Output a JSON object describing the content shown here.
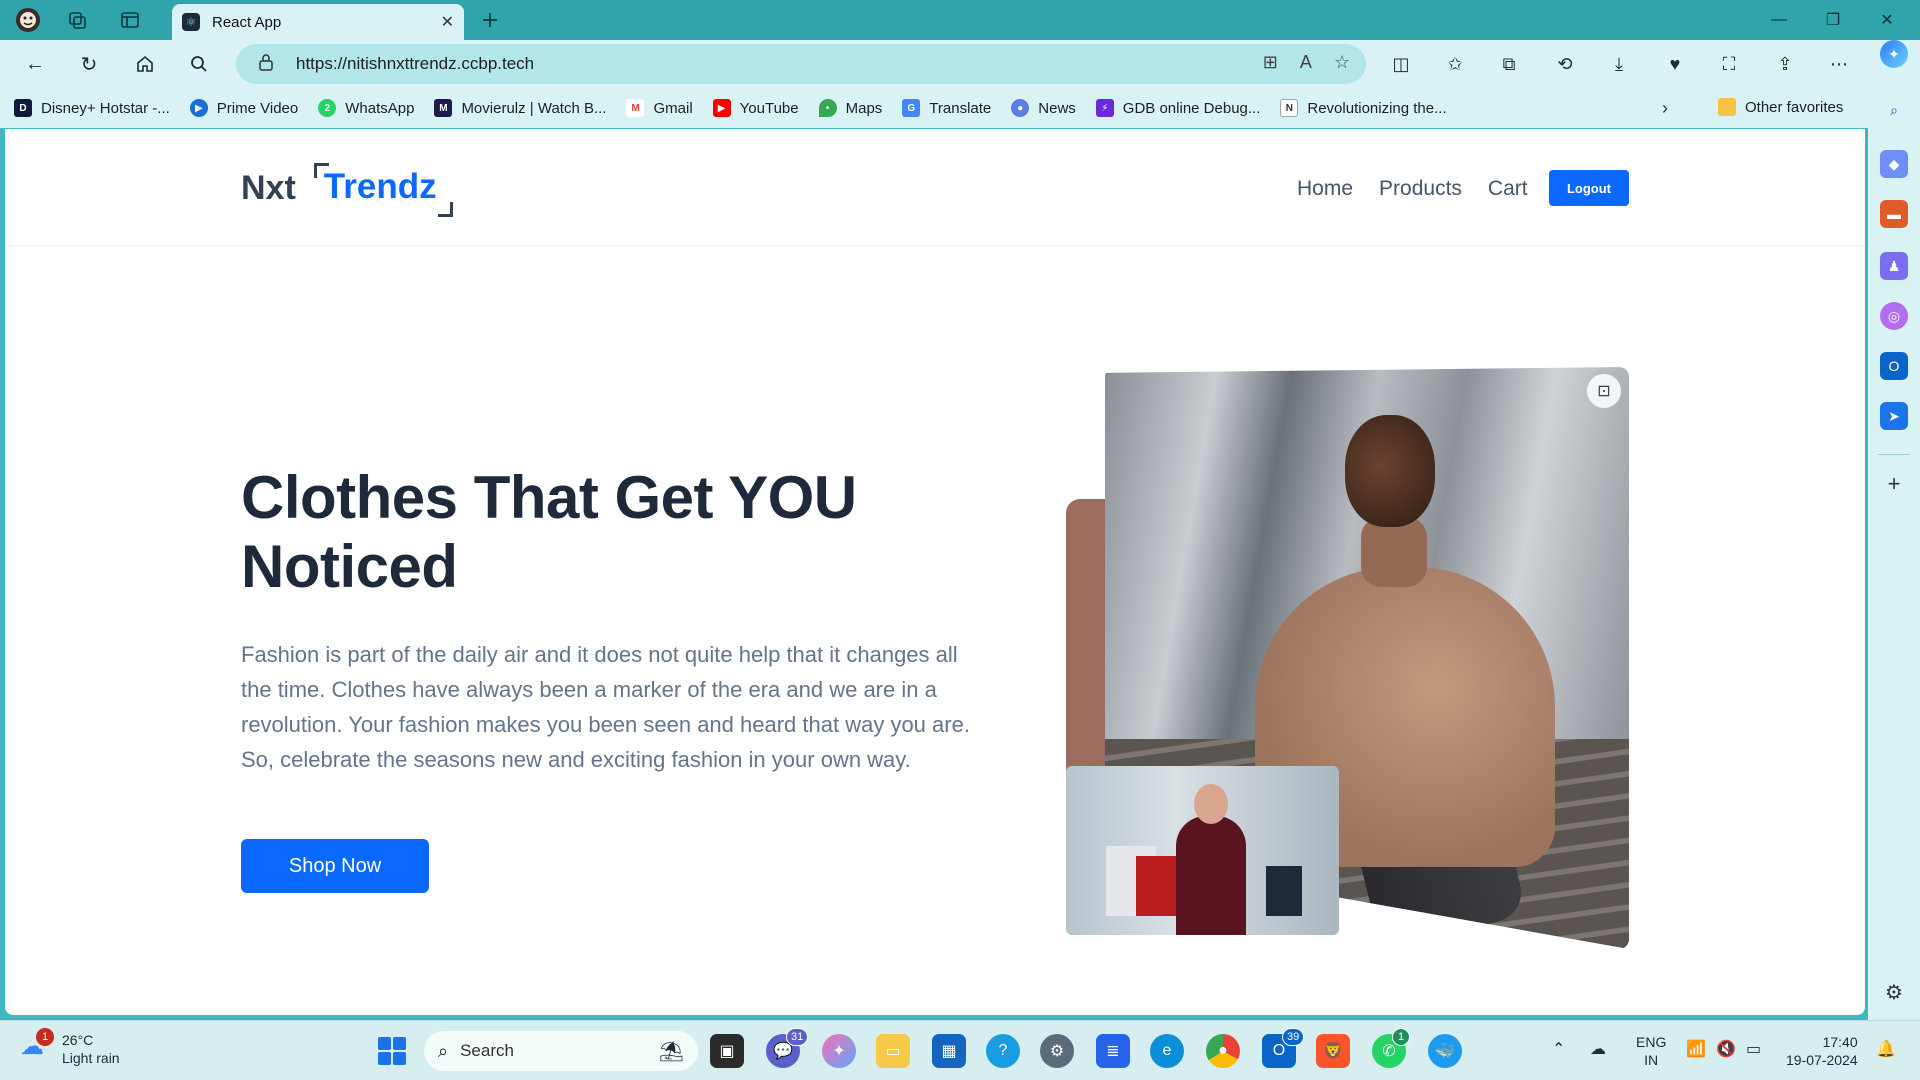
{
  "browser": {
    "tab_title": "React App",
    "url": "https://nitishnxttrendz.ccbp.tech",
    "favorites": [
      {
        "label": "Disney+ Hotstar -...",
        "icon": "hotstar-icon",
        "color": "#0f1a3c"
      },
      {
        "label": "Prime Video",
        "icon": "prime-video-icon",
        "color": "#1a6fd6"
      },
      {
        "label": "WhatsApp",
        "icon": "whatsapp-icon",
        "color": "#25d366"
      },
      {
        "label": "Movierulz | Watch B...",
        "icon": "movierulz-icon",
        "color": "#1e1b4b"
      },
      {
        "label": "Gmail",
        "icon": "gmail-icon",
        "color": "#ea4335"
      },
      {
        "label": "YouTube",
        "icon": "youtube-icon",
        "color": "#ff0000"
      },
      {
        "label": "Maps",
        "icon": "maps-icon",
        "color": "#34a853"
      },
      {
        "label": "Translate",
        "icon": "translate-icon",
        "color": "#4285f4"
      },
      {
        "label": "News",
        "icon": "news-icon",
        "color": "#5b7fde"
      },
      {
        "label": "GDB online Debug...",
        "icon": "gdb-icon",
        "color": "#6d28d9"
      },
      {
        "label": "Revolutionizing the...",
        "icon": "nxtwave-icon",
        "color": "#9ca3af"
      }
    ],
    "other_favorites": "Other favorites"
  },
  "page": {
    "logo_prefix": "Nxt",
    "logo_brand": "Trendz",
    "nav": {
      "home": "Home",
      "products": "Products",
      "cart": "Cart",
      "logout": "Logout"
    },
    "hero_title": "Clothes That Get YOU Noticed",
    "hero_description": "Fashion is part of the daily air and it does not quite help that it changes all the time. Clothes have always been a marker of the era and we are in a revolution. Your fashion makes you been seen and heard that way you are. So, celebrate the seasons new and exciting fashion in your own way.",
    "shop_button": "Shop Now",
    "accent_color": "#0b69ff"
  },
  "taskbar": {
    "weather_temp": "26°C",
    "weather_desc": "Light rain",
    "weather_badge": "1",
    "search_placeholder": "Search",
    "teams_badge": "31",
    "outlook_badge": "39",
    "whatsapp_badge": "1",
    "language_line1": "ENG",
    "language_line2": "IN",
    "time": "17:40",
    "date": "19-07-2024"
  }
}
